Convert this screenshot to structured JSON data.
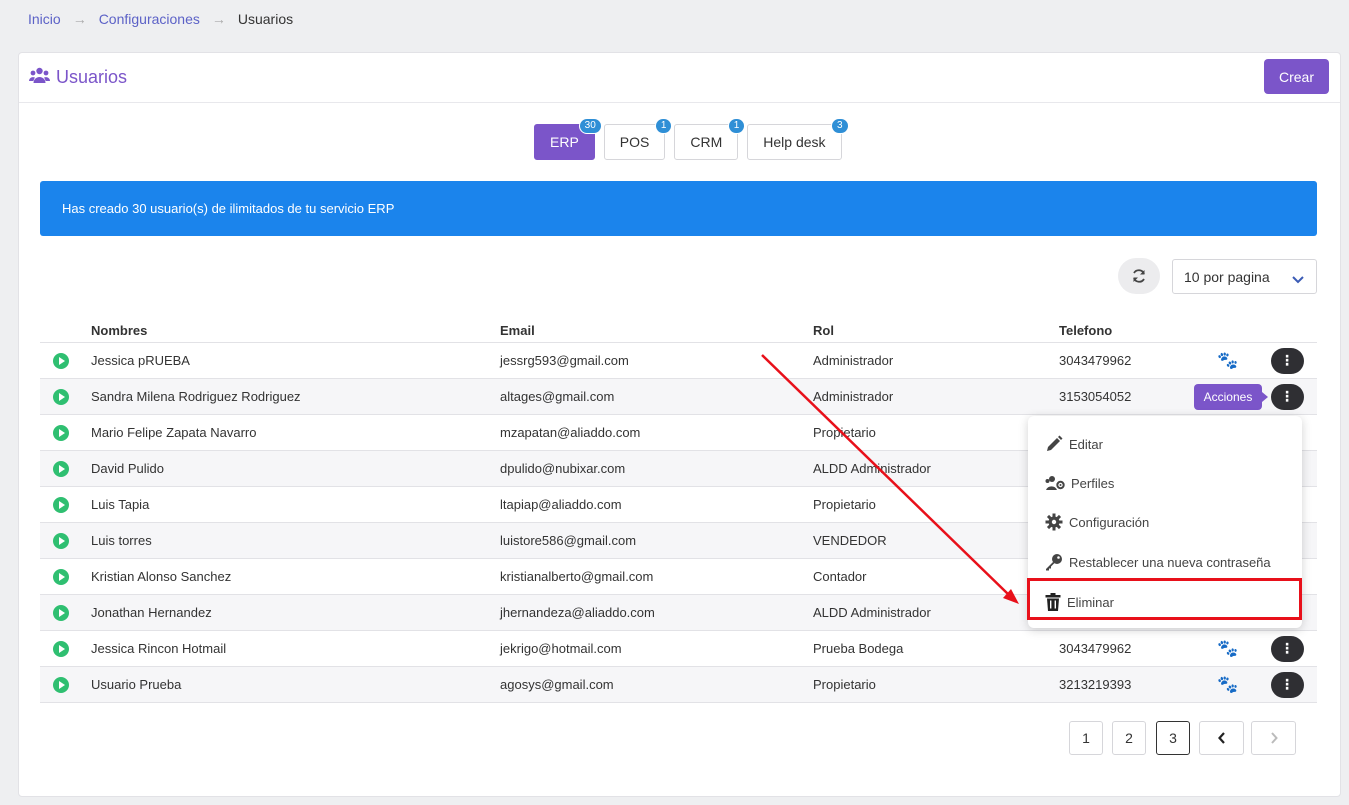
{
  "breadcrumb": {
    "home": "Inicio",
    "config": "Configuraciones",
    "current": "Usuarios",
    "sep": "→"
  },
  "header": {
    "title": "Usuarios",
    "create_label": "Crear"
  },
  "tabs": [
    {
      "label": "ERP",
      "badge": "30",
      "active": true
    },
    {
      "label": "POS",
      "badge": "1"
    },
    {
      "label": "CRM",
      "badge": "1"
    },
    {
      "label": "Help desk",
      "badge": "3"
    }
  ],
  "alert": "Has creado 30 usuario(s) de ilimitados de tu servicio ERP",
  "per_page": "10 por pagina",
  "table": {
    "headers": [
      "Nombres",
      "Email",
      "Rol",
      "Telefono"
    ],
    "rows": [
      {
        "name": "Jessica pRUEBA",
        "email": "jessrg593@gmail.com",
        "role": "Administrador",
        "phone": "3043479962"
      },
      {
        "name": "Sandra Milena Rodriguez Rodriguez",
        "email": "altages@gmail.com",
        "role": "Administrador",
        "phone": "3153054052"
      },
      {
        "name": "Mario Felipe Zapata Navarro",
        "email": "mzapatan@aliaddo.com",
        "role": "Propietario",
        "phone": ""
      },
      {
        "name": "David Pulido",
        "email": "dpulido@nubixar.com",
        "role": "ALDD Administrador",
        "phone": ""
      },
      {
        "name": "Luis Tapia",
        "email": "ltapiap@aliaddo.com",
        "role": "Propietario",
        "phone": ""
      },
      {
        "name": "Luis torres",
        "email": "luistore586@gmail.com",
        "role": "VENDEDOR",
        "phone": ""
      },
      {
        "name": "Kristian Alonso Sanchez",
        "email": "kristianalberto@gmail.com",
        "role": "Contador",
        "phone": ""
      },
      {
        "name": "Jonathan Hernandez",
        "email": "jhernandeza@aliaddo.com",
        "role": "ALDD Administrador",
        "phone": ""
      },
      {
        "name": "Jessica Rincon Hotmail",
        "email": "jekrigo@hotmail.com",
        "role": "Prueba Bodega",
        "phone": "3043479962"
      },
      {
        "name": "Usuario Prueba",
        "email": "agosys@gmail.com",
        "role": "Propietario",
        "phone": "3213219393"
      }
    ]
  },
  "tooltip": "Acciones",
  "menu": {
    "edit": "Editar",
    "profiles": "Perfiles",
    "config": "Configuración",
    "reset": "Restablecer una nueva contraseña",
    "delete": "Eliminar"
  },
  "pagination": {
    "p1": "1",
    "p2": "2",
    "p3": "3",
    "current": "3"
  },
  "colors": {
    "accent": "#7b55c9",
    "alert": "#1b84ec",
    "highlight": "#e8101a",
    "play": "#2fbf71"
  }
}
